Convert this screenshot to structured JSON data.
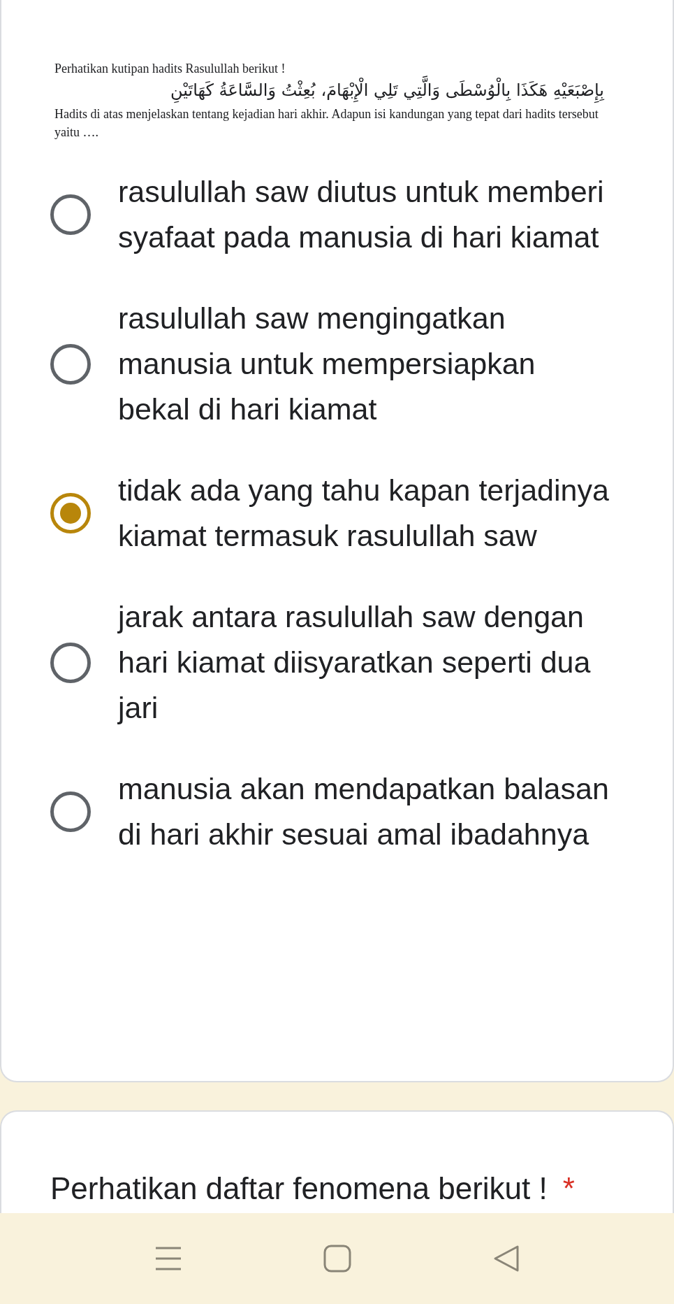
{
  "question": {
    "intro": "Perhatikan kutipan hadits Rasulullah berikut !",
    "arabic": "بِإِصْبَعَيْهِ هَكَذَا بِالْوُسْطَى وَالَّتِي تَلِي الْإِبْهَامَ، بُعِثْتُ وَالسَّاعَةُ كَهَاتَيْنِ",
    "body": "Hadits di atas menjelaskan tentang kejadian hari akhir. Adapun isi kandungan yang tepat dari hadits tersebut yaitu …."
  },
  "options": [
    {
      "label": "rasulullah saw diutus untuk memberi syafaat pada manusia di hari kiamat",
      "selected": false
    },
    {
      "label": "rasulullah saw mengingatkan manusia untuk mempersiapkan bekal di hari kiamat",
      "selected": false
    },
    {
      "label": "tidak ada yang tahu kapan terjadinya kiamat termasuk rasulullah saw",
      "selected": true
    },
    {
      "label": "jarak antara rasulullah saw dengan hari kiamat diisyaratkan seperti dua jari",
      "selected": false
    },
    {
      "label": "manusia akan mendapatkan balasan di hari akhir sesuai amal ibadahnya",
      "selected": false
    }
  ],
  "next_question": {
    "title": "Perhatikan daftar fenomena berikut !",
    "required_mark": "*"
  }
}
